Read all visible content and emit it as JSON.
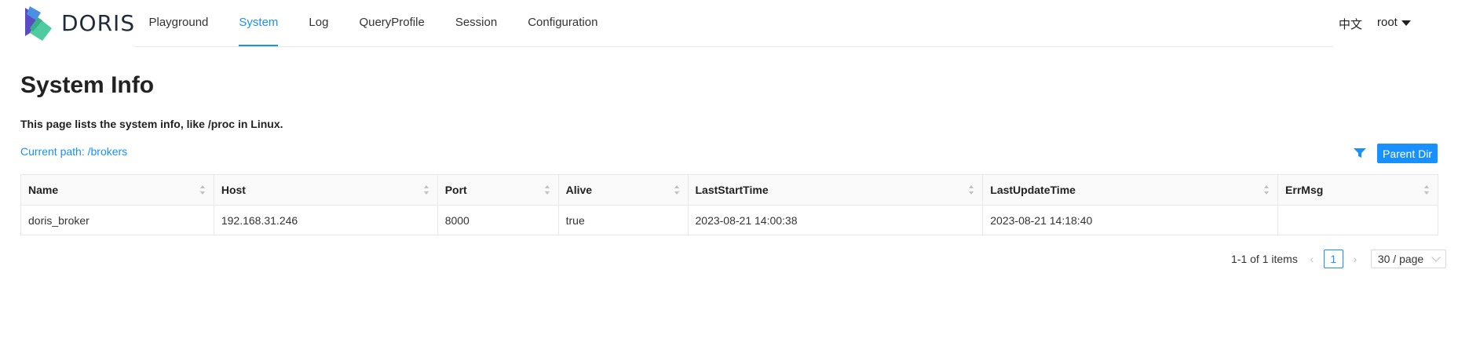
{
  "header": {
    "logo_text": "DORIS",
    "nav": [
      {
        "label": "Playground",
        "active": false
      },
      {
        "label": "System",
        "active": true
      },
      {
        "label": "Log",
        "active": false
      },
      {
        "label": "QueryProfile",
        "active": false
      },
      {
        "label": "Session",
        "active": false
      },
      {
        "label": "Configuration",
        "active": false
      }
    ],
    "language": "中文",
    "user": "root"
  },
  "page": {
    "title": "System Info",
    "description": "This page lists the system info, like /proc in Linux.",
    "current_path": "Current path: /brokers",
    "parent_dir_label": "Parent Dir"
  },
  "table": {
    "columns": [
      "Name",
      "Host",
      "Port",
      "Alive",
      "LastStartTime",
      "LastUpdateTime",
      "ErrMsg"
    ],
    "rows": [
      [
        "doris_broker",
        "192.168.31.246",
        "8000",
        "true",
        "2023-08-21 14:00:38",
        "2023-08-21 14:18:40",
        ""
      ]
    ]
  },
  "pagination": {
    "total_text": "1-1 of 1 items",
    "current_page": "1",
    "page_size": "30 / page"
  },
  "colors": {
    "accent": "#1890ff",
    "logo_purple": "#6a4fd0",
    "logo_teal": "#4ecba0"
  }
}
